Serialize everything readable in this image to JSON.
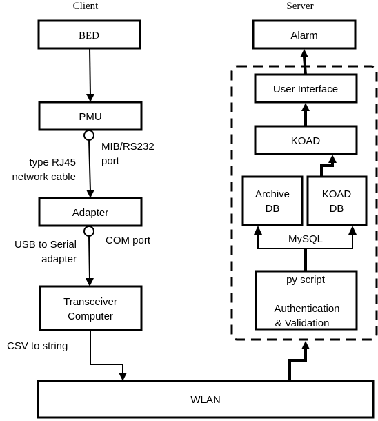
{
  "headers": {
    "client": "Client",
    "server": "Server"
  },
  "client_nodes": {
    "bed": "BED",
    "pmu": "PMU",
    "adapter": "Adapter",
    "transceiver_line1": "Transceiver",
    "transceiver_line2": "Computer"
  },
  "client_labels": {
    "mib_line1": "MIB/RS232",
    "mib_line2": "port",
    "rj45_line1": "type RJ45",
    "rj45_line2": "network cable",
    "com_port": "COM port",
    "usb_line1": "USB  to Serial",
    "usb_line2": "adapter",
    "csv": "CSV to string"
  },
  "server_nodes": {
    "alarm": "Alarm",
    "user_interface": "User Interface",
    "koad": "KOAD",
    "archive_db_line1": "Archive",
    "archive_db_line2": "DB",
    "koad_db_line1": "KOAD",
    "koad_db_line2": "DB",
    "mysql": "MySQL",
    "py_script": "py script",
    "auth_line1": "Authentication",
    "auth_line2": "& Validation"
  },
  "network": {
    "wlan": "WLAN"
  }
}
